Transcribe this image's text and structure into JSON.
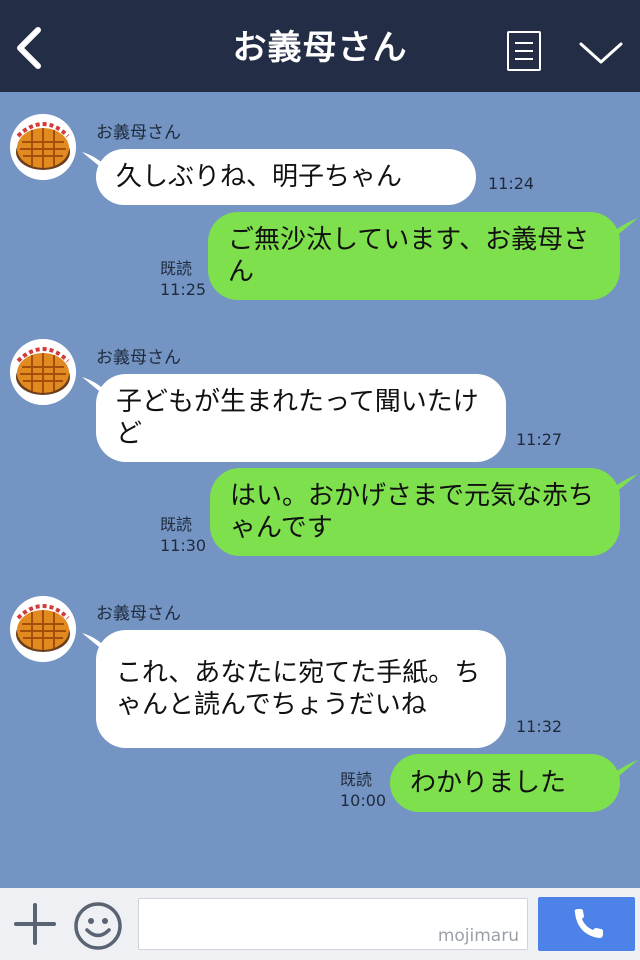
{
  "header": {
    "title": "お義母さん",
    "back_icon": "chevron-left-icon",
    "menu_icon": "list-icon",
    "expand_icon": "chevron-down-icon"
  },
  "messages": [
    {
      "sender": "お義母さん",
      "text": "久しぶりね、明子ちゃん",
      "time": "11:24"
    },
    {
      "text": "ご無沙汰しています、お義母さん",
      "read": "既読",
      "time": "11:25"
    },
    {
      "sender": "お義母さん",
      "text": "子どもが生まれたって聞いたけど",
      "time": "11:27"
    },
    {
      "text": "はい。おかげさまで元気な赤ちゃんです",
      "read": "既読",
      "time": "11:30"
    },
    {
      "sender": "お義母さん",
      "text": "これ、あなたに宛てた手紙。ちゃんと読んでちょうだいね",
      "time": "11:32"
    },
    {
      "text": "わかりました",
      "read": "既読",
      "time": "10:00"
    }
  ],
  "input": {
    "placeholder": "",
    "watermark": "mojimaru",
    "plus_icon": "plus-icon",
    "sticker_icon": "smiley-icon",
    "call_icon": "phone-icon"
  },
  "colors": {
    "header_bg": "#232d45",
    "chat_bg": "#7495c3",
    "incoming_bubble": "#ffffff",
    "outgoing_bubble": "#7ee04c",
    "call_button": "#4d82e8"
  }
}
